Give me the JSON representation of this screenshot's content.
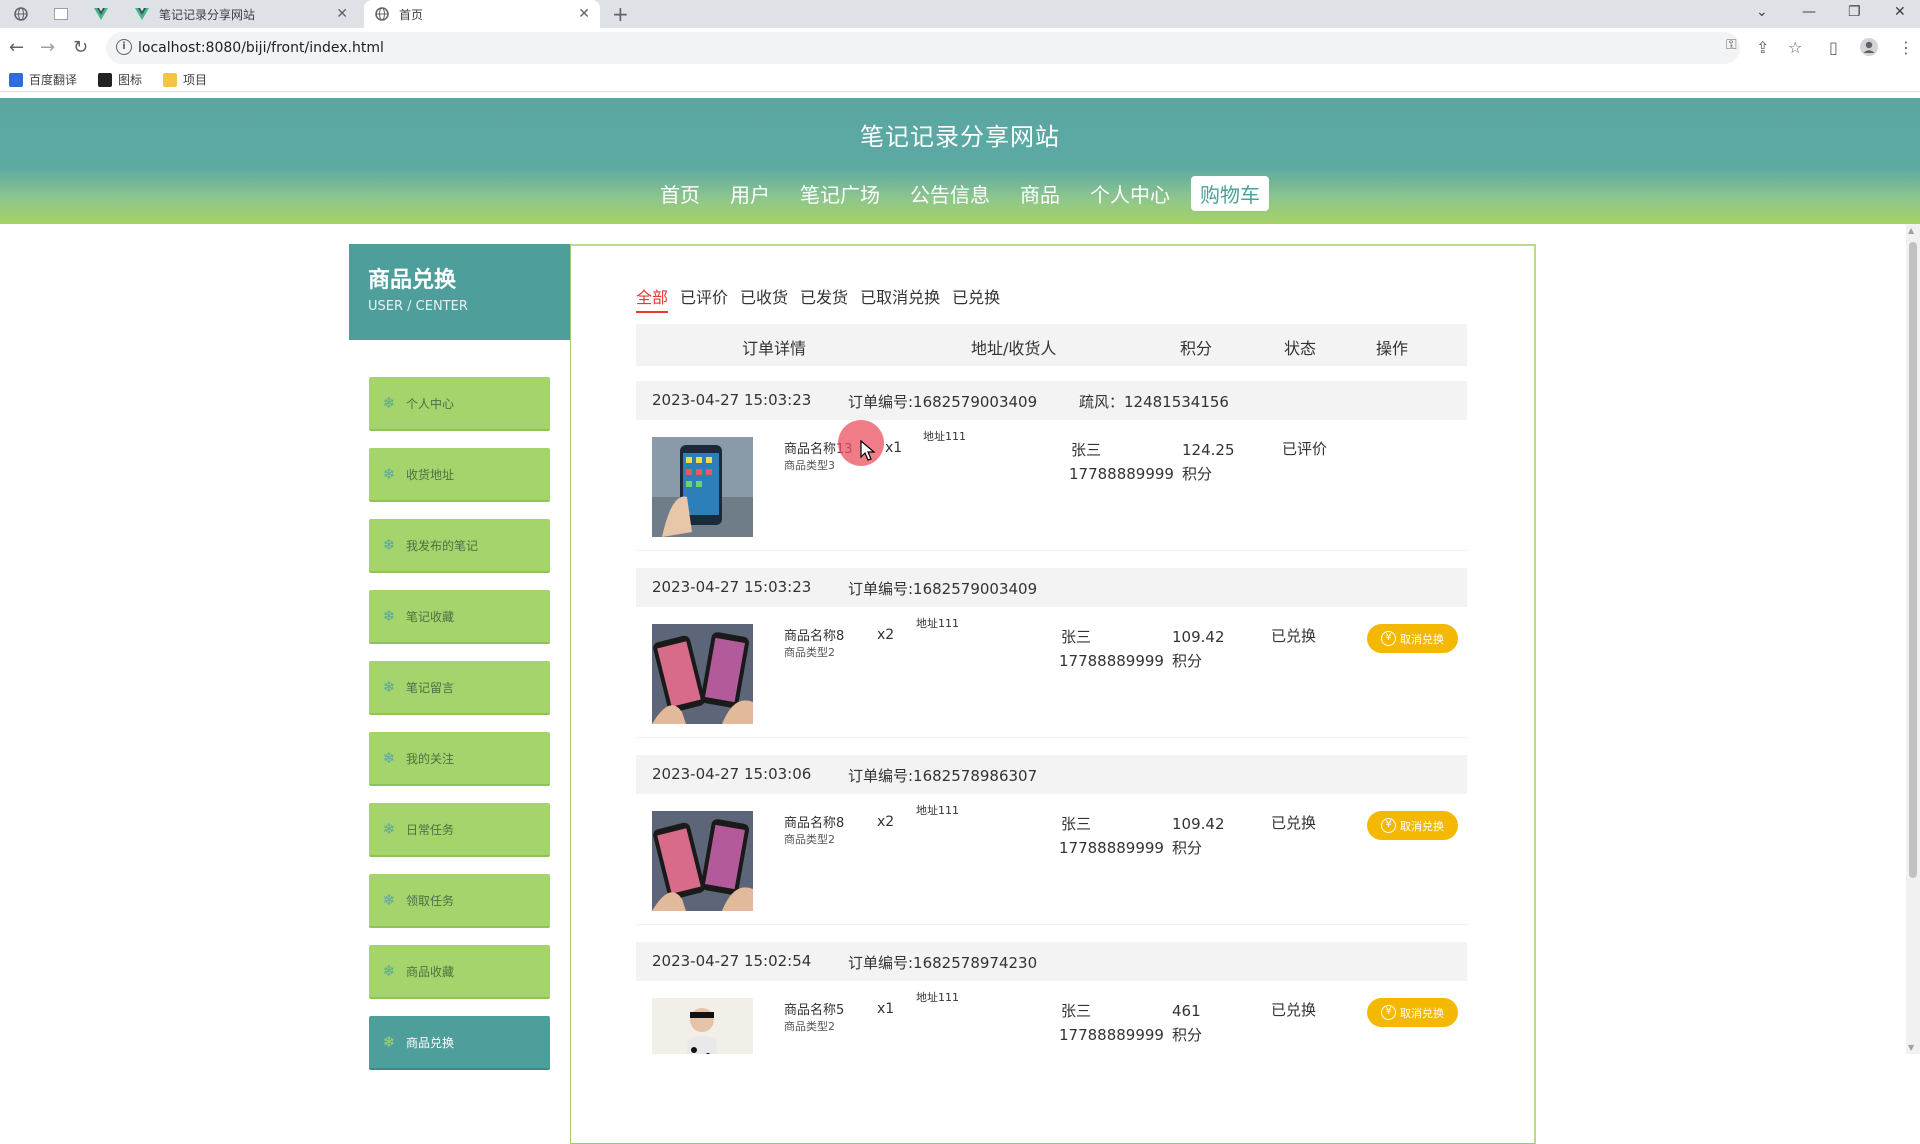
{
  "browser": {
    "tabs": [
      {
        "title": "笔记记录分享网站",
        "active": false
      },
      {
        "title": "首页",
        "active": true
      }
    ],
    "new_tab": "+",
    "url": "localhost:8080/biji/front/index.html",
    "bookmarks": [
      "百度翻译",
      "图标",
      "项目"
    ]
  },
  "site": {
    "title": "笔记记录分享网站",
    "nav": [
      "首页",
      "用户",
      "笔记广场",
      "公告信息",
      "商品",
      "个人中心",
      "购物车"
    ],
    "active_nav": "购物车"
  },
  "sidebar": {
    "title": "商品兑换",
    "subtitle": "USER / CENTER",
    "items": [
      {
        "label": "个人中心"
      },
      {
        "label": "收货地址"
      },
      {
        "label": "我发布的笔记"
      },
      {
        "label": "笔记收藏"
      },
      {
        "label": "笔记留言"
      },
      {
        "label": "我的关注"
      },
      {
        "label": "日常任务"
      },
      {
        "label": "领取任务"
      },
      {
        "label": "商品收藏"
      },
      {
        "label": "商品兑换"
      }
    ],
    "active_item": "商品兑换"
  },
  "filters": {
    "tabs": [
      "全部",
      "已评价",
      "已收货",
      "已发货",
      "已取消兑换",
      "已兑换"
    ],
    "active": "全部"
  },
  "table": {
    "headers": [
      "订单详情",
      "地址/收货人",
      "积分",
      "状态",
      "操作"
    ]
  },
  "orders": [
    {
      "time": "2023-04-27 15:03:23",
      "order_no": "订单编号:1682579003409",
      "extra": "疏风：12481534156",
      "product": "商品名称13",
      "type": "商品类型3",
      "qty": "x1",
      "address": "地址111",
      "name": "张三",
      "phone": "17788889999",
      "points": "124.25",
      "points_unit": "积分",
      "status": "已评价",
      "action": ""
    },
    {
      "time": "2023-04-27 15:03:23",
      "order_no": "订单编号:1682579003409",
      "extra": "",
      "product": "商品名称8",
      "type": "商品类型2",
      "qty": "x2",
      "address": "地址111",
      "name": "张三",
      "phone": "17788889999",
      "points": "109.42",
      "points_unit": "积分",
      "status": "已兑换",
      "action": "取消兑换"
    },
    {
      "time": "2023-04-27 15:03:06",
      "order_no": "订单编号:1682578986307",
      "extra": "",
      "product": "商品名称8",
      "type": "商品类型2",
      "qty": "x2",
      "address": "地址111",
      "name": "张三",
      "phone": "17788889999",
      "points": "109.42",
      "points_unit": "积分",
      "status": "已兑换",
      "action": "取消兑换"
    },
    {
      "time": "2023-04-27 15:02:54",
      "order_no": "订单编号:1682578974230",
      "extra": "",
      "product": "商品名称5",
      "type": "商品类型2",
      "qty": "x1",
      "address": "地址111",
      "name": "张三",
      "phone": "17788889999",
      "points": "461",
      "points_unit": "积分",
      "status": "已兑换",
      "action": "取消兑换"
    }
  ],
  "colors": {
    "header_teal": "#5ba6a1",
    "header_green": "#a6d264",
    "sidebar_green": "#a5d46c",
    "accent_red": "#e53935",
    "button_yellow": "#f5b800"
  }
}
